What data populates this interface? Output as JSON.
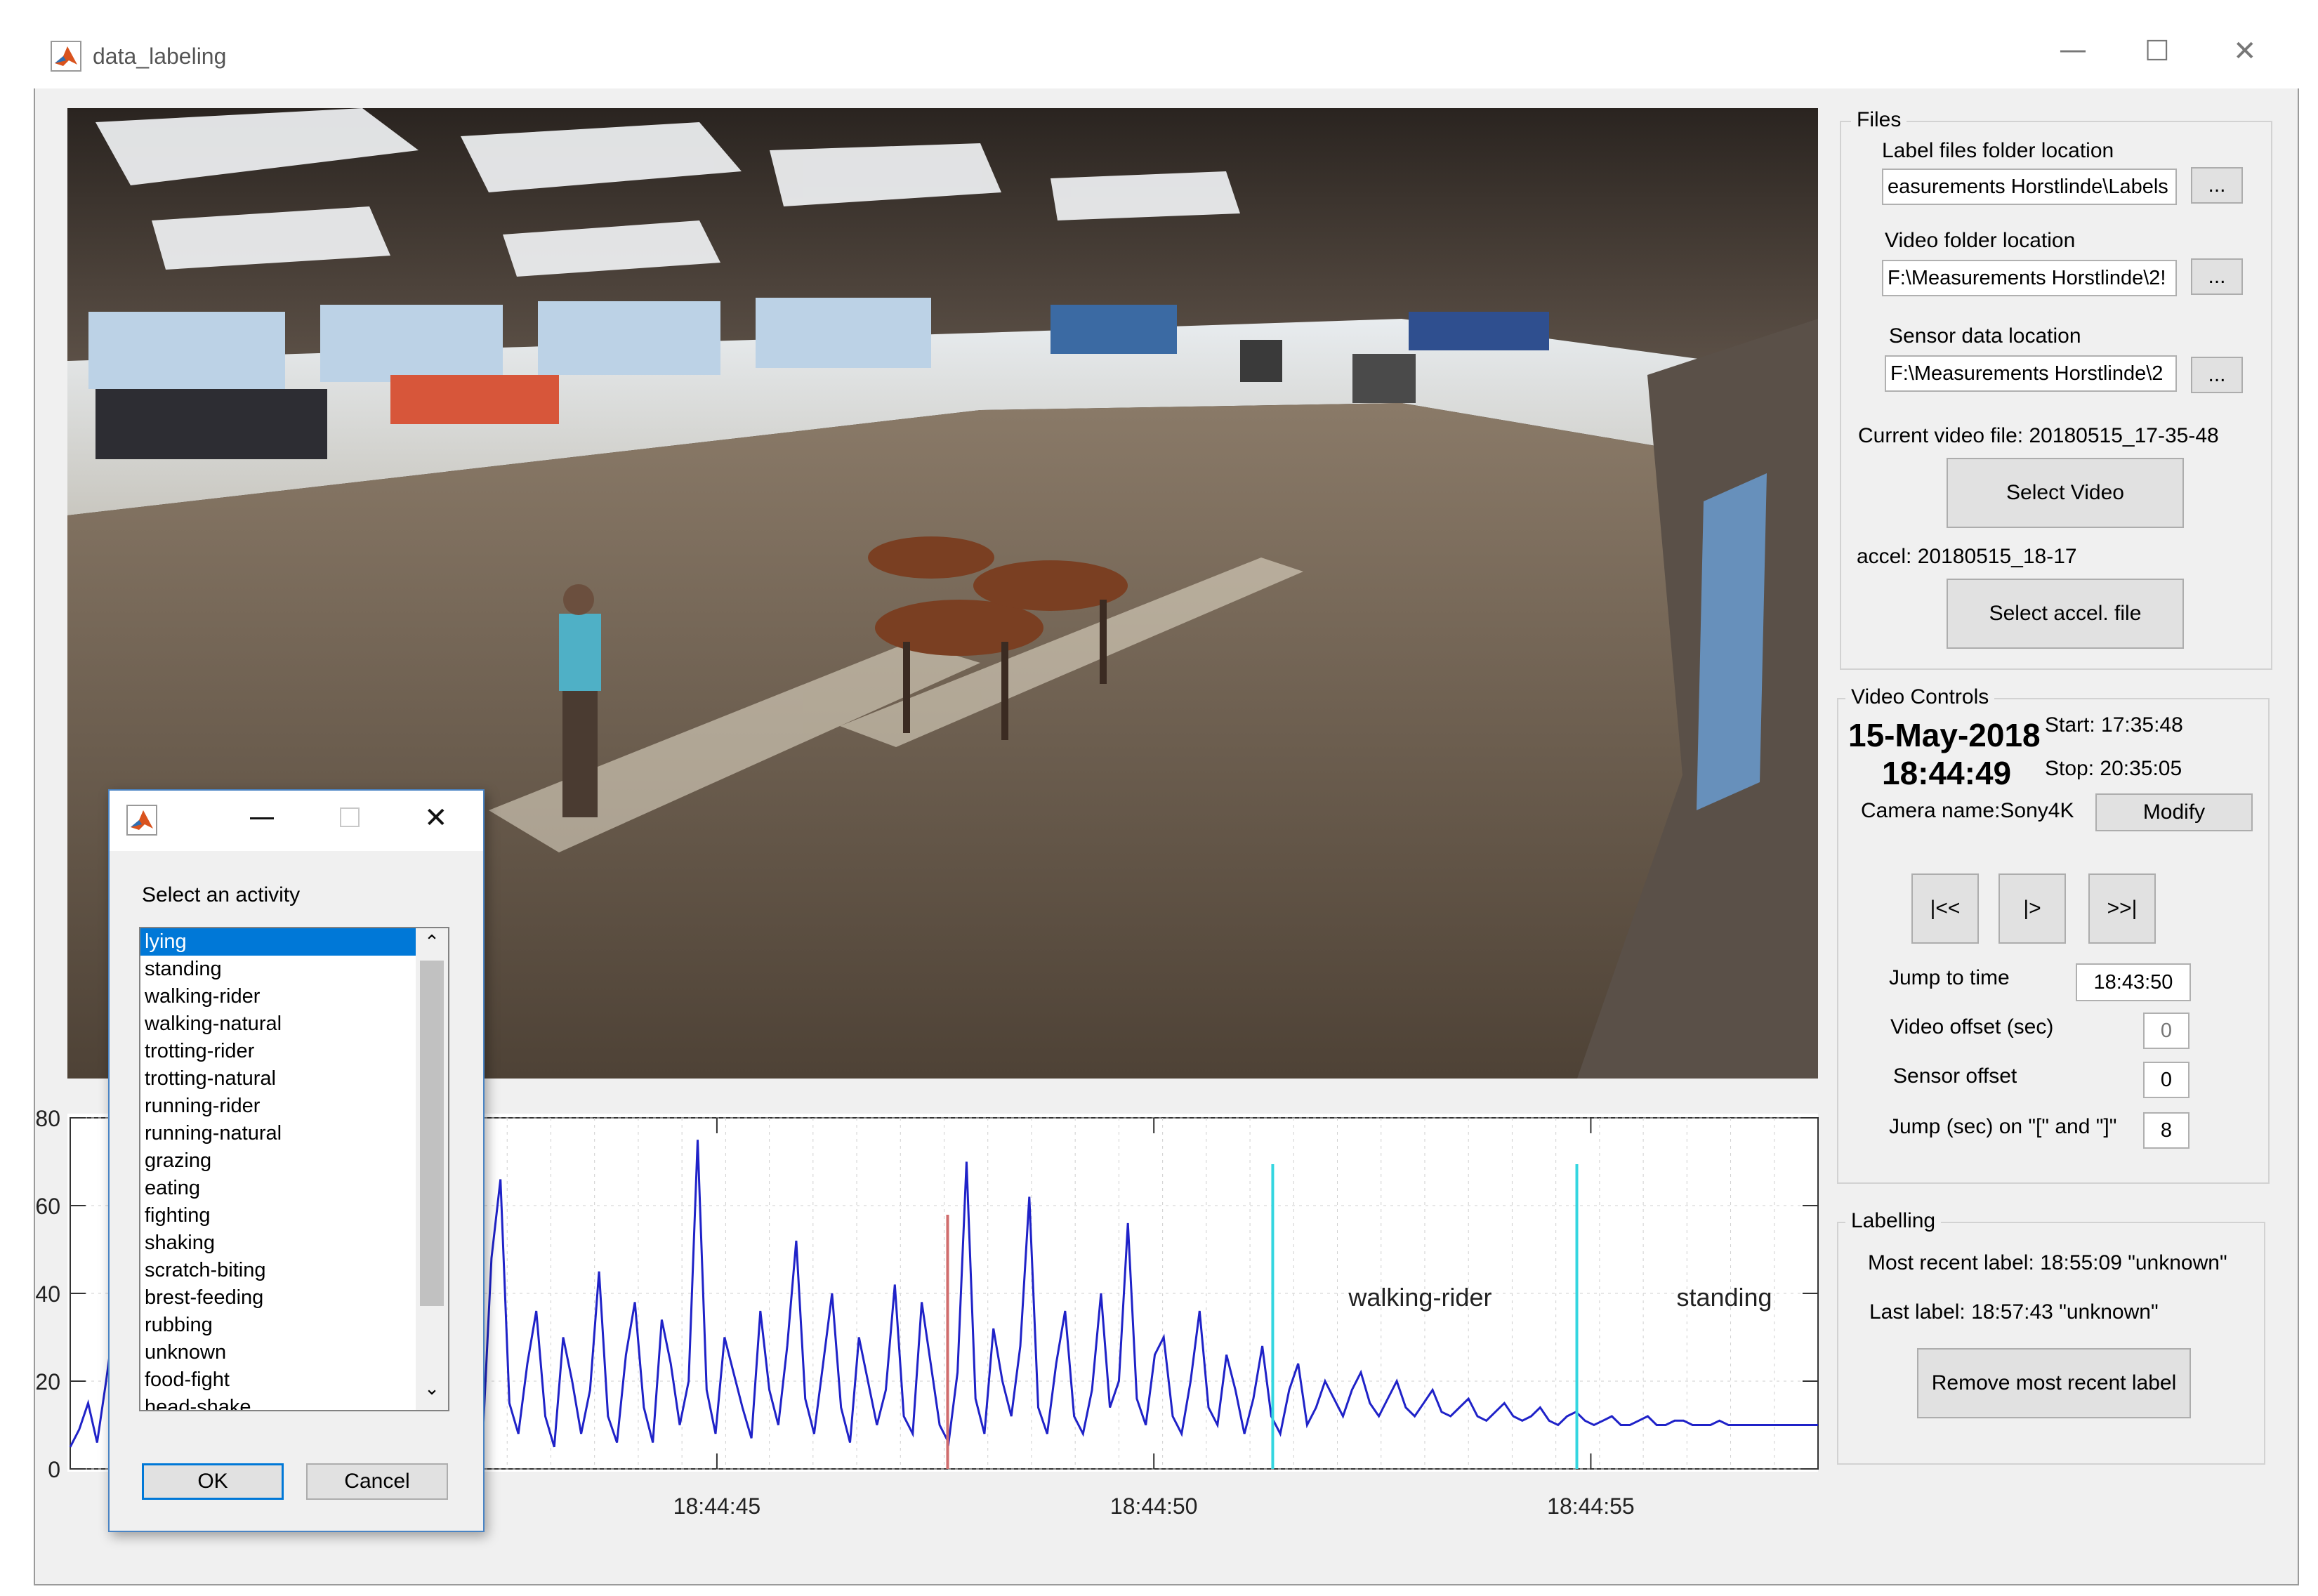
{
  "window": {
    "title": "data_labeling",
    "minimize": "—",
    "maximize": "☐",
    "close": "✕"
  },
  "files": {
    "group_title": "Files",
    "label_folder_label": "Label files folder location",
    "label_folder_value": "easurements Horstlinde\\Labels",
    "video_folder_label": "Video folder location",
    "video_folder_value": "F:\\Measurements Horstlinde\\2!",
    "sensor_label": "Sensor data location",
    "sensor_value": "F:\\Measurements Horstlinde\\2",
    "browse": "...",
    "current_video": "Current video file: 20180515_17-35-48",
    "select_video": "Select Video",
    "accel": "accel: 20180515_18-17",
    "select_accel": "Select accel. file"
  },
  "video_controls": {
    "group_title": "Video Controls",
    "date": "15-May-2018",
    "time": "18:44:49",
    "start": "Start: 17:35:48",
    "stop": "Stop: 20:35:05",
    "camera": "Camera name:Sony4K",
    "modify": "Modify",
    "btn_start": "|<<",
    "btn_play": "|>",
    "btn_end": ">>|",
    "jump_label": "Jump to time",
    "jump_value": "18:43:50",
    "video_offset_label": "Video offset (sec)",
    "video_offset_value": "0",
    "sensor_offset_label": "Sensor offset",
    "sensor_offset_value": "0",
    "jump_sec_label": "Jump (sec) on \"[\" and \"]\"",
    "jump_sec_value": "8"
  },
  "labelling": {
    "group_title": "Labelling",
    "most_recent": "Most recent label: 18:55:09 \"unknown\"",
    "last": "Last label: 18:57:43 \"unknown\"",
    "remove": "Remove most recent label"
  },
  "dialog": {
    "prompt": "Select an activity",
    "ok": "OK",
    "cancel": "Cancel",
    "close": "✕",
    "items": [
      "lying",
      "standing",
      "walking-rider",
      "walking-natural",
      "trotting-rider",
      "trotting-natural",
      "running-rider",
      "running-natural",
      "grazing",
      "eating",
      "fighting",
      "shaking",
      "scratch-biting",
      "brest-feeding",
      "rubbing",
      "unknown",
      "food-fight",
      "head-shake"
    ]
  },
  "colors": {
    "signal": "#1f22c8",
    "marker_cyan": "#34d6e0",
    "marker_red": "#d06d6d"
  },
  "chart_data": {
    "type": "line",
    "ytick_labels": [
      "0",
      "20",
      "40",
      "60",
      "80"
    ],
    "xtick_labels": [
      "18:44:45",
      "18:44:50",
      "18:44:55"
    ],
    "ylim": [
      0,
      80
    ],
    "grid": true,
    "series": [
      {
        "values": [
          5,
          9,
          15,
          6,
          20,
          35,
          18,
          9,
          4,
          22,
          40,
          14,
          6,
          30,
          50,
          12,
          7,
          25,
          44,
          10,
          5,
          35,
          80,
          20,
          8,
          30,
          18,
          6,
          42,
          70,
          15,
          5,
          28,
          18,
          8,
          38,
          55,
          14,
          6,
          22,
          40,
          10,
          7,
          32,
          28,
          12,
          6,
          48,
          66,
          15,
          8,
          24,
          36,
          12,
          5,
          30,
          20,
          8,
          18,
          45,
          12,
          6,
          26,
          38,
          14,
          6,
          34,
          24,
          10,
          20,
          75,
          18,
          8,
          30,
          22,
          14,
          7,
          36,
          18,
          10,
          28,
          52,
          16,
          8,
          24,
          40,
          14,
          6,
          30,
          20,
          10,
          18,
          42,
          12,
          8,
          38,
          24,
          10,
          6,
          22,
          70,
          16,
          8,
          32,
          20,
          12,
          28,
          62,
          14,
          8,
          24,
          36,
          12,
          8,
          18,
          40,
          14,
          20,
          56,
          16,
          10,
          26,
          30,
          12,
          8,
          20,
          36,
          14,
          10,
          26,
          18,
          8,
          16,
          28,
          12,
          8,
          18,
          24,
          10,
          14,
          20,
          16,
          12,
          18,
          22,
          15,
          12,
          16,
          20,
          14,
          12,
          15,
          18,
          13,
          12,
          14,
          16,
          12,
          11,
          13,
          15,
          12,
          11,
          12,
          14,
          11,
          10,
          12,
          13,
          11,
          10,
          11,
          12,
          10,
          10,
          11,
          12,
          10,
          10,
          11,
          11,
          10,
          10,
          10,
          11,
          10,
          10,
          10,
          10,
          10,
          10,
          10,
          10,
          10,
          10,
          10
        ]
      }
    ],
    "markers": [
      {
        "x_fraction": 0.502,
        "color": "red"
      },
      {
        "x_fraction": 0.688,
        "color": "cyan",
        "label": "walking-rider"
      },
      {
        "x_fraction": 0.862,
        "color": "cyan",
        "label": "standing"
      }
    ]
  }
}
